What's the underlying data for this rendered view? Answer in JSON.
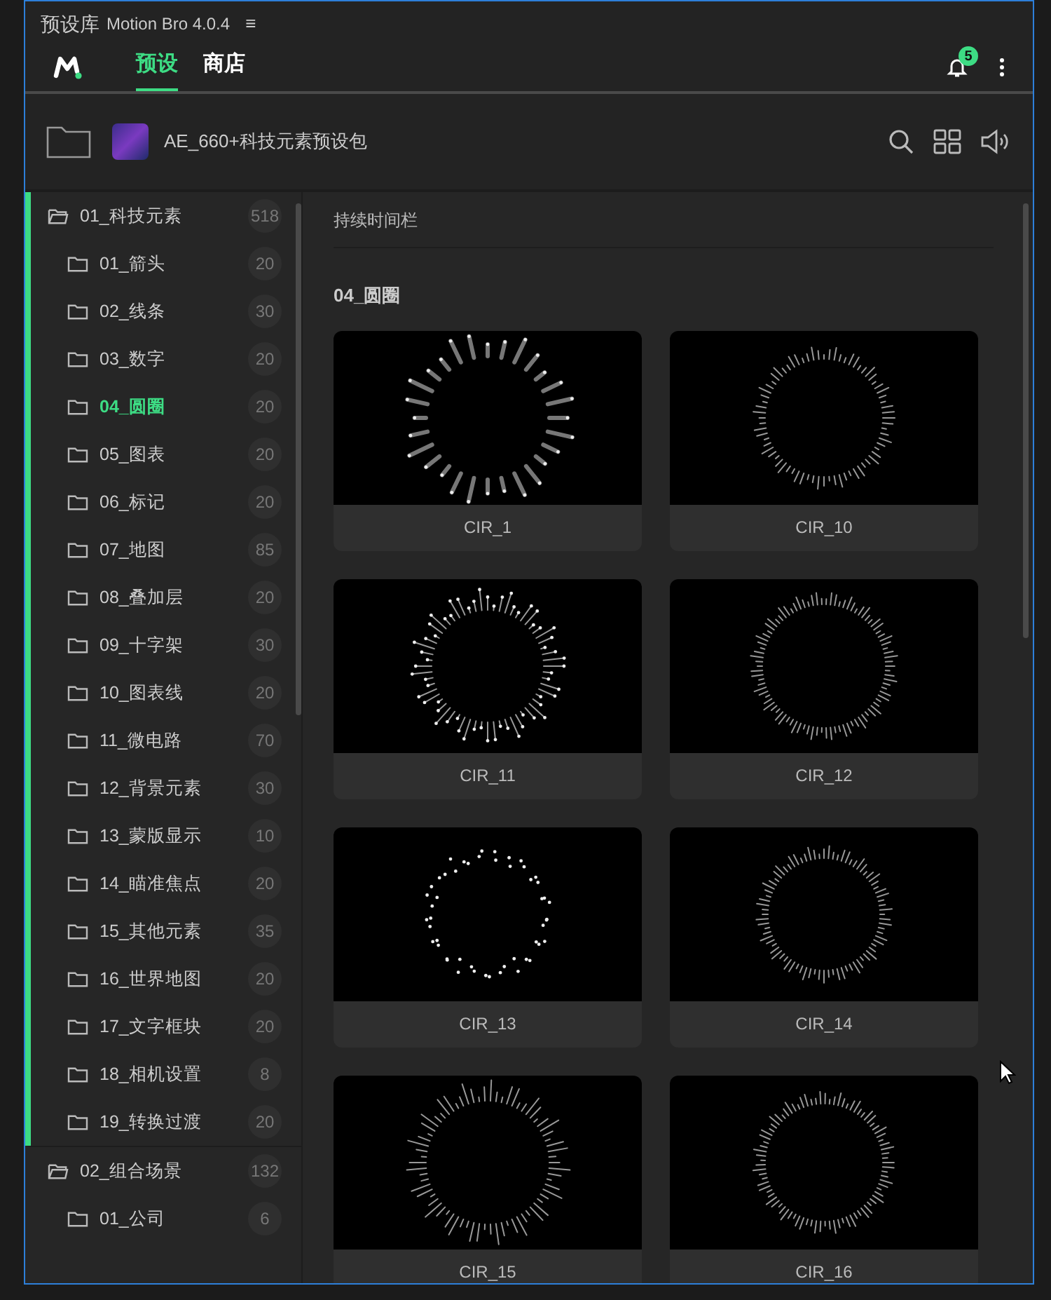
{
  "window": {
    "title": "预设库",
    "app_version": "Motion Bro 4.0.4",
    "menu_glyph": "≡"
  },
  "nav": {
    "tabs": [
      {
        "label": "预设",
        "selected": true
      },
      {
        "label": "商店",
        "selected": false
      }
    ],
    "notification_count": "5"
  },
  "toolbar": {
    "pack_name": "AE_660+科技元素预设包"
  },
  "sidebar": {
    "items": [
      {
        "label": "01_科技元素",
        "count": "518",
        "expanded": true,
        "children": [
          {
            "label": "01_箭头",
            "count": "20",
            "selected": false
          },
          {
            "label": "02_线条",
            "count": "30",
            "selected": false
          },
          {
            "label": "03_数字",
            "count": "20",
            "selected": false
          },
          {
            "label": "04_圆圈",
            "count": "20",
            "selected": true
          },
          {
            "label": "05_图表",
            "count": "20",
            "selected": false
          },
          {
            "label": "06_标记",
            "count": "20",
            "selected": false
          },
          {
            "label": "07_地图",
            "count": "85",
            "selected": false
          },
          {
            "label": "08_叠加层",
            "count": "20",
            "selected": false
          },
          {
            "label": "09_十字架",
            "count": "30",
            "selected": false
          },
          {
            "label": "10_图表线",
            "count": "20",
            "selected": false
          },
          {
            "label": "11_微电路",
            "count": "70",
            "selected": false
          },
          {
            "label": "12_背景元素",
            "count": "30",
            "selected": false
          },
          {
            "label": "13_蒙版显示",
            "count": "10",
            "selected": false
          },
          {
            "label": "14_瞄准焦点",
            "count": "20",
            "selected": false
          },
          {
            "label": "15_其他元素",
            "count": "35",
            "selected": false
          },
          {
            "label": "16_世界地图",
            "count": "20",
            "selected": false
          },
          {
            "label": "17_文字框块",
            "count": "20",
            "selected": false
          },
          {
            "label": "18_相机设置",
            "count": "8",
            "selected": false
          },
          {
            "label": "19_转换过渡",
            "count": "20",
            "selected": false
          }
        ]
      },
      {
        "label": "02_组合场景",
        "count": "132",
        "expanded": true,
        "children": [
          {
            "label": "01_公司",
            "count": "6",
            "selected": false
          }
        ]
      }
    ]
  },
  "main": {
    "duration_bar": "持续时间栏",
    "section_title": "04_圆圈",
    "presets": [
      {
        "name": "CIR_1"
      },
      {
        "name": "CIR_10"
      },
      {
        "name": "CIR_11"
      },
      {
        "name": "CIR_12"
      },
      {
        "name": "CIR_13"
      },
      {
        "name": "CIR_14"
      },
      {
        "name": "CIR_15"
      },
      {
        "name": "CIR_16"
      }
    ]
  }
}
